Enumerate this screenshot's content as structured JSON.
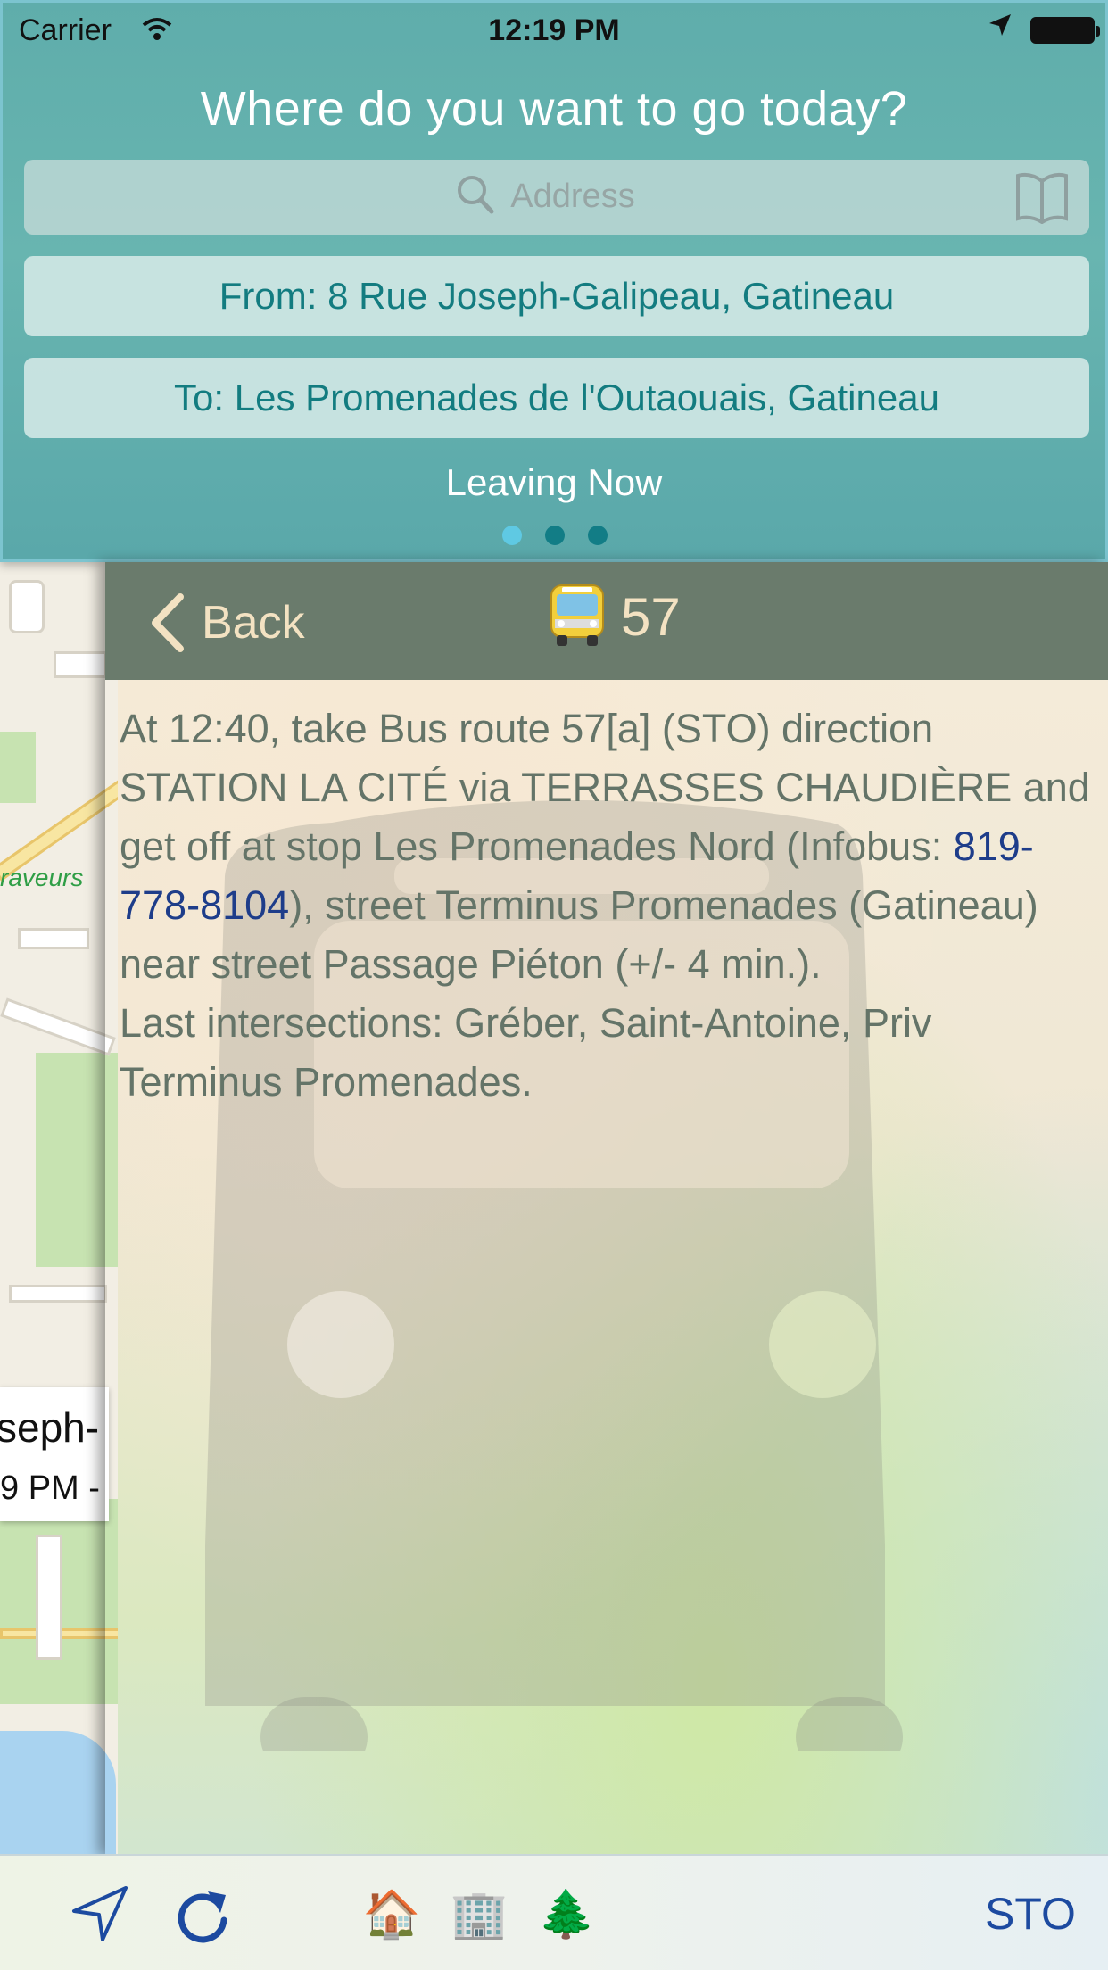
{
  "status_bar": {
    "carrier": "Carrier",
    "time": "12:19 PM"
  },
  "search_panel": {
    "prompt": "Where do you want to go today?",
    "search_placeholder": "Address",
    "from": "From: 8 Rue Joseph-Galipeau, Gatineau",
    "to": "To: Les Promenades de l'Outaouais, Gatineau",
    "timing": "Leaving Now",
    "page_dots": [
      {
        "color": "#5fc9e3",
        "active": true
      },
      {
        "color": "#127d86",
        "active": false
      },
      {
        "color": "#127d86",
        "active": false
      }
    ]
  },
  "map": {
    "road_label": "raveurs",
    "callout_title": "seph-",
    "callout_sub": "9 PM -"
  },
  "step": {
    "back_label": "Back",
    "route_icon": "bus-icon",
    "route_number": "57",
    "text_before_phone": "At 12:40, take Bus route 57[a] (STO) direction STATION LA CITÉ via TERRASSES CHAUDIÈRE and get off at stop Les Promenades Nord (Infobus: ",
    "phone": "819-778-8104",
    "text_after_phone": "), street Terminus Promenades (Gatineau) near street Passage Piéton (+/- 4 min.).",
    "last_intersections": "Last intersections: Gréber, Saint-Antoine, Priv Terminus Promenades."
  },
  "toolbar": {
    "items": [
      {
        "icon": "navigation-arrow-icon"
      },
      {
        "icon": "refresh-icon"
      },
      {
        "icon": "house-icon",
        "glyph": "🏠"
      },
      {
        "icon": "office-building-icon",
        "glyph": "🏢"
      },
      {
        "icon": "tree-icon",
        "glyph": "🌲"
      }
    ],
    "agency_label": "STO"
  },
  "colors": {
    "panel_teal": "#62b0ad",
    "route_text": "#137c80",
    "header_green": "#6a7b6c",
    "header_text": "#f3e2c2",
    "body_text": "#647468",
    "phone_link": "#1e3d8a",
    "sto_blue": "#1c4aa0"
  }
}
